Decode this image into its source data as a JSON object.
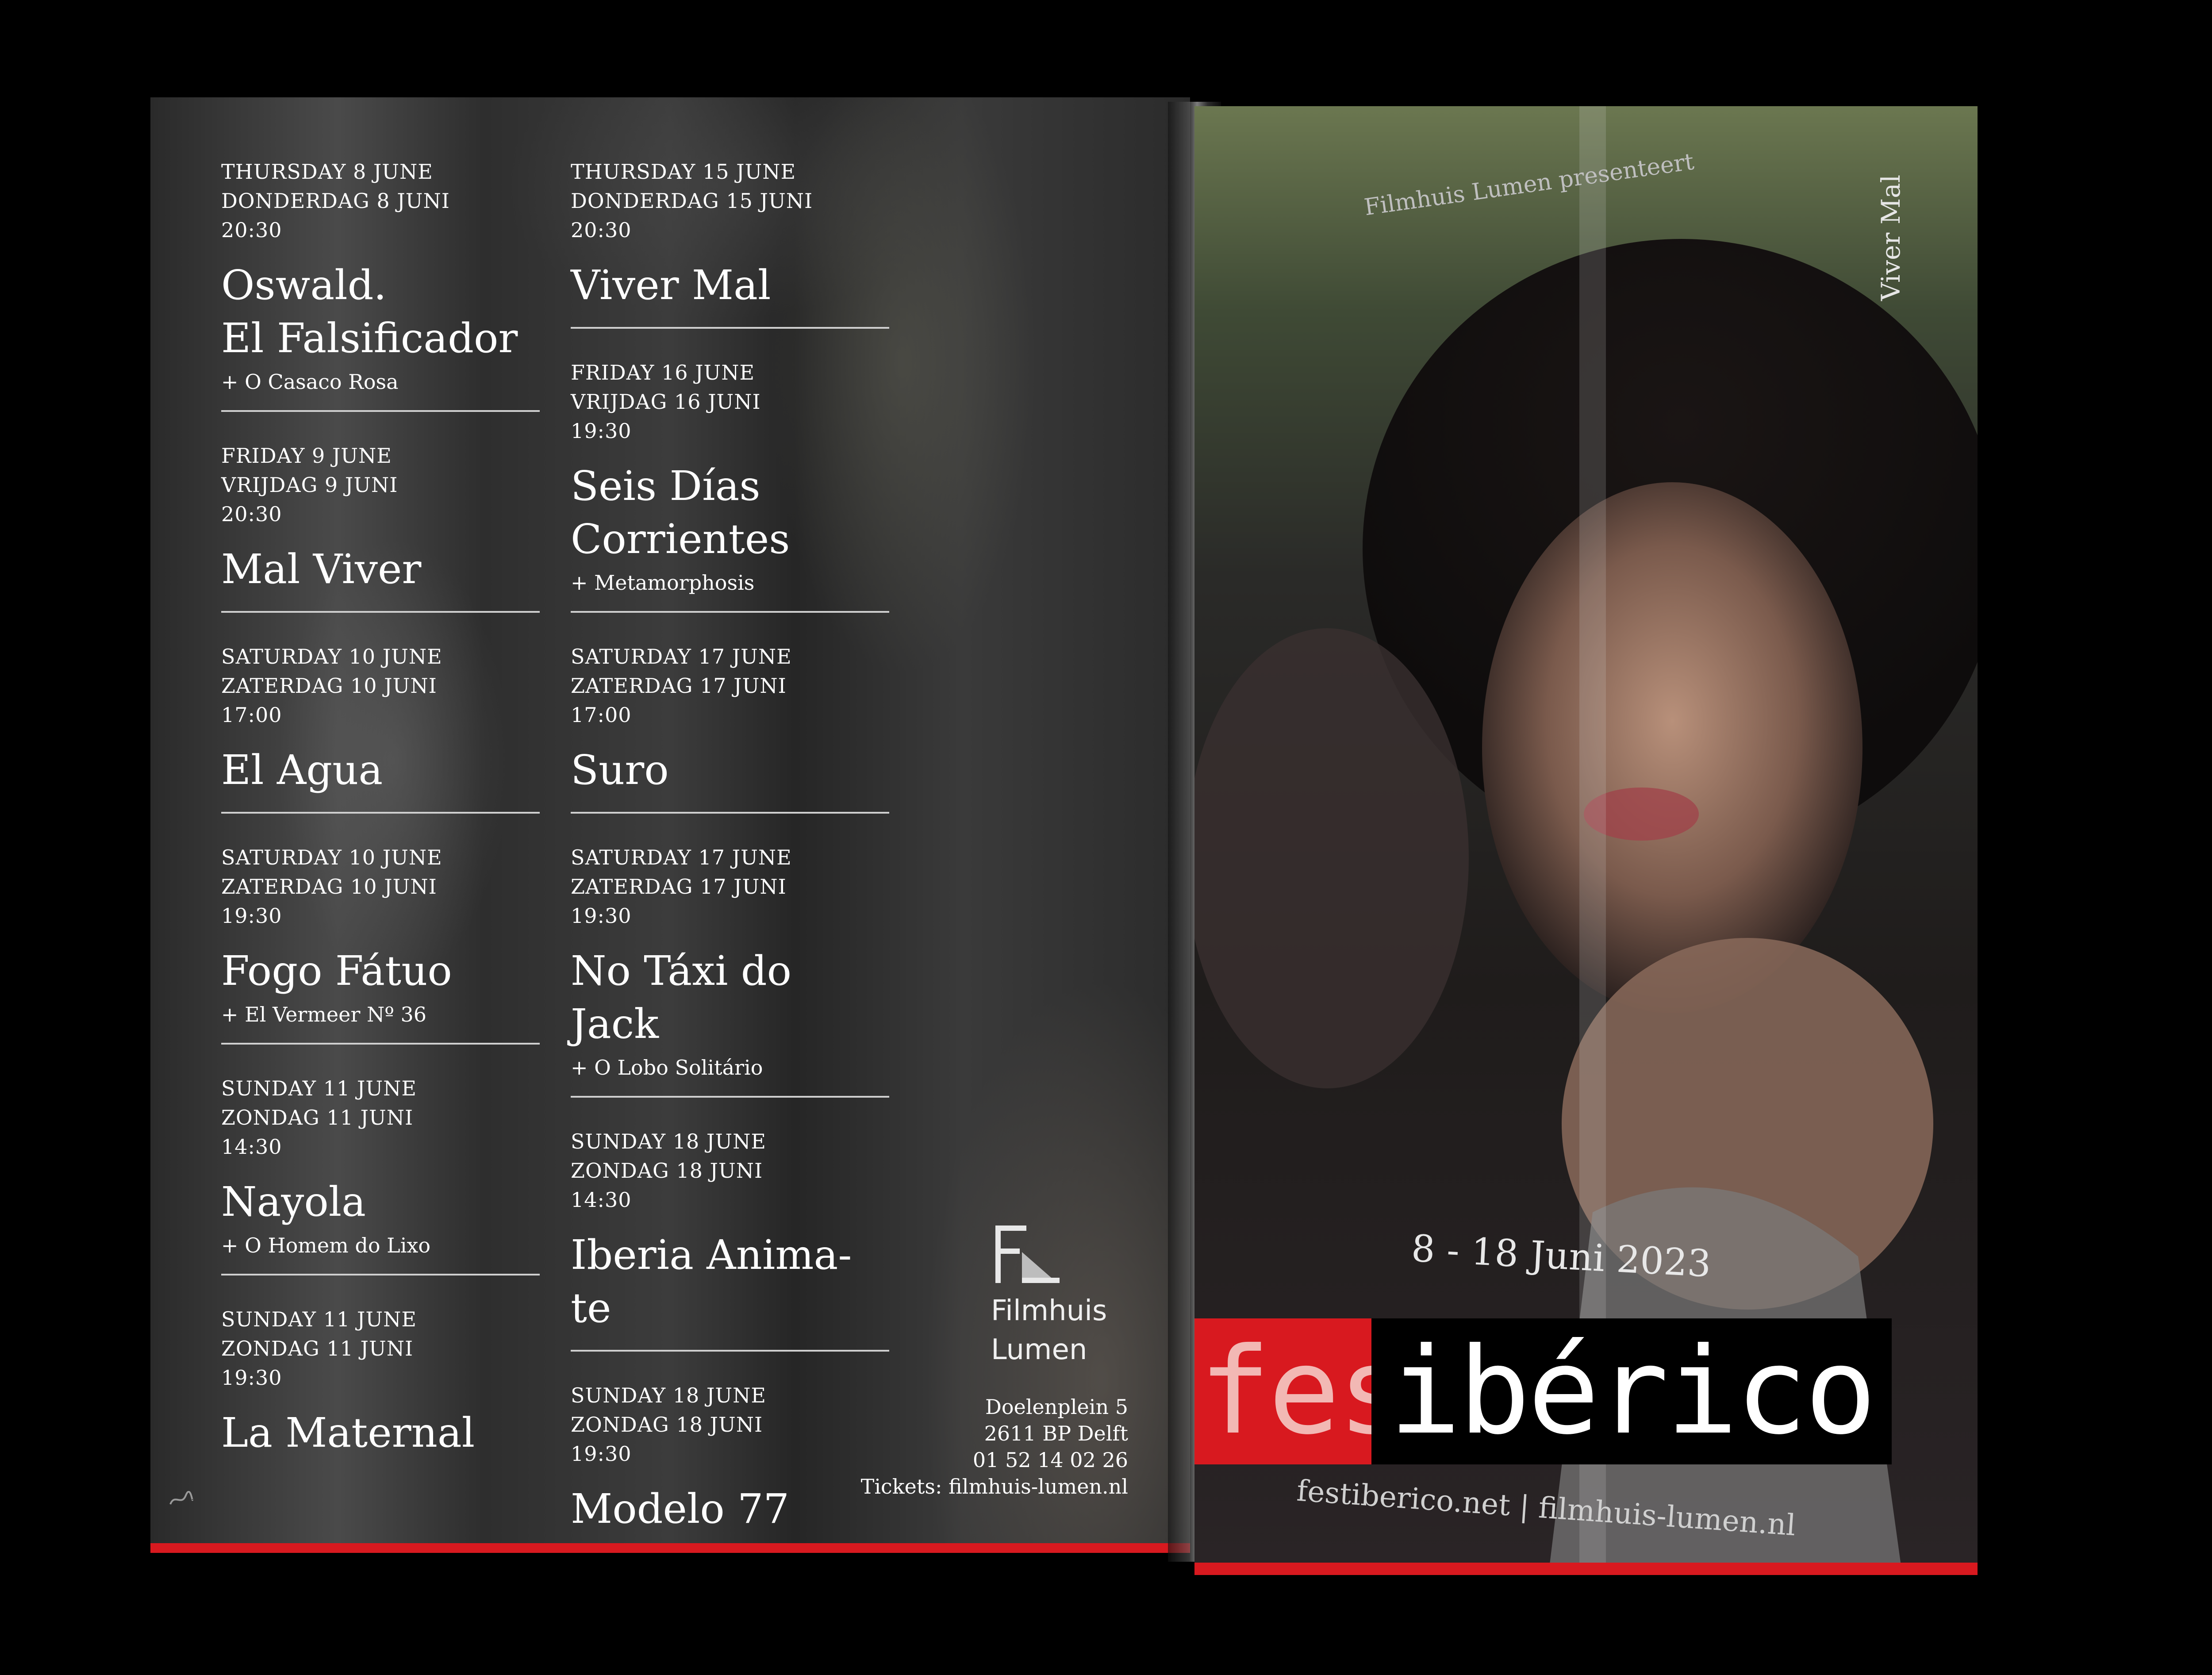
{
  "left_page": {
    "column_a": [
      {
        "en": "THURSDAY 8 JUNE",
        "nl": "DONDERDAG 8 JUNI",
        "time": "20:30",
        "title_lines": [
          "Oswald.",
          "El Falsificador"
        ],
        "extra": "+ O Casaco Rosa"
      },
      {
        "en": "FRIDAY 9 JUNE",
        "nl": "VRIJDAG 9 JUNI",
        "time": "20:30",
        "title_lines": [
          "Mal Viver"
        ],
        "extra": ""
      },
      {
        "en": "SATURDAY 10 JUNE",
        "nl": "ZATERDAG 10 JUNI",
        "time": "17:00",
        "title_lines": [
          "El Agua"
        ],
        "extra": ""
      },
      {
        "en": "SATURDAY 10 JUNE",
        "nl": "ZATERDAG 10 JUNI",
        "time": "19:30",
        "title_lines": [
          "Fogo Fátuo"
        ],
        "extra": "+ El Vermeer Nº 36"
      },
      {
        "en": "SUNDAY 11 JUNE",
        "nl": "ZONDAG 11 JUNI",
        "time": "14:30",
        "title_lines": [
          "Nayola"
        ],
        "extra": "+ O Homem do Lixo"
      },
      {
        "en": "SUNDAY 11 JUNE",
        "nl": "ZONDAG 11 JUNI",
        "time": "19:30",
        "title_lines": [
          "La Maternal"
        ],
        "extra": ""
      }
    ],
    "column_b": [
      {
        "en": "THURSDAY 15 JUNE",
        "nl": "DONDERDAG 15 JUNI",
        "time": "20:30",
        "title_lines": [
          "Viver Mal"
        ],
        "extra": ""
      },
      {
        "en": "FRIDAY 16 JUNE",
        "nl": "VRIJDAG 16 JUNI",
        "time": "19:30",
        "title_lines": [
          "Seis Días",
          "Corrientes"
        ],
        "extra": "+ Metamorphosis"
      },
      {
        "en": "SATURDAY 17 JUNE",
        "nl": "ZATERDAG 17 JUNI",
        "time": "17:00",
        "title_lines": [
          "Suro"
        ],
        "extra": ""
      },
      {
        "en": "SATURDAY 17 JUNE",
        "nl": "ZATERDAG 17 JUNI",
        "time": "19:30",
        "title_lines": [
          "No Táxi do Jack"
        ],
        "extra": "+ O Lobo Solitário"
      },
      {
        "en": "SUNDAY 18 JUNE",
        "nl": "ZONDAG 18 JUNI",
        "time": "14:30",
        "title_lines": [
          "Iberia Anima-te"
        ],
        "extra": ""
      },
      {
        "en": "SUNDAY 18 JUNE",
        "nl": "ZONDAG 18 JUNI",
        "time": "19:30",
        "title_lines": [
          "Modelo 77"
        ],
        "extra": ""
      }
    ],
    "logo": {
      "line1": "Filmhuis",
      "line2": "Lumen"
    },
    "address": {
      "street": "Doelenplein 5",
      "city": "2611 BP Delft",
      "phone": "01 52 14 02 26",
      "tickets": "Tickets: filmhuis-lumen.nl"
    },
    "colors": {
      "accent": "#d8191f",
      "text": "#ffffff"
    }
  },
  "right_page": {
    "presents": "Filmhuis Lumen presenteert",
    "side_title": "Viver Mal",
    "dates": "8 - 18 Juni 2023",
    "logo_part1": "fest",
    "logo_part2": "ibérico",
    "urls": "festiberico.net | filmhuis-lumen.nl"
  }
}
